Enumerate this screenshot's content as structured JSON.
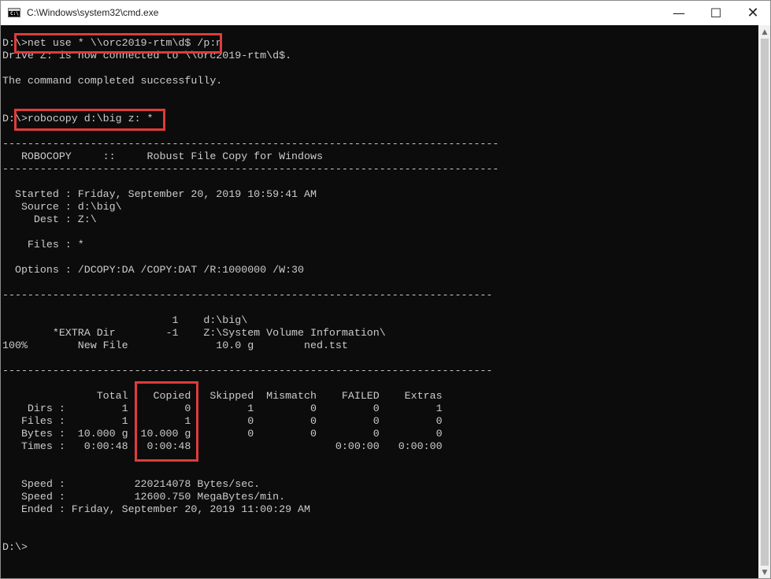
{
  "window": {
    "title": "C:\\Windows\\system32\\cmd.exe",
    "icon_text": "C:\\",
    "minimize_glyph": "—",
    "maximize_glyph": "☐",
    "close_glyph": "✕"
  },
  "console": {
    "lines": [
      "D:\\>net use * \\\\orc2019-rtm\\d$ /p:n",
      "Drive Z: is now connected to \\\\orc2019-rtm\\d$.",
      "",
      "The command completed successfully.",
      "",
      "",
      "D:\\>robocopy d:\\big z: *",
      "",
      "-------------------------------------------------------------------------------",
      "   ROBOCOPY     ::     Robust File Copy for Windows",
      "-------------------------------------------------------------------------------",
      "",
      "  Started : Friday, September 20, 2019 10:59:41 AM",
      "   Source : d:\\big\\",
      "     Dest : Z:\\",
      "",
      "    Files : *",
      "",
      "  Options : /DCOPY:DA /COPY:DAT /R:1000000 /W:30",
      "",
      "------------------------------------------------------------------------------",
      "",
      "                           1    d:\\big\\",
      "        *EXTRA Dir        -1    Z:\\System Volume Information\\",
      "100%        New File              10.0 g        ned.tst",
      "",
      "------------------------------------------------------------------------------",
      "",
      "               Total    Copied   Skipped  Mismatch    FAILED    Extras",
      "    Dirs :         1         0         1         0         0         1",
      "   Files :         1         1         0         0         0         0",
      "   Bytes :  10.000 g  10.000 g         0         0         0         0",
      "   Times :   0:00:48   0:00:48                       0:00:00   0:00:00",
      "",
      "",
      "   Speed :           220214078 Bytes/sec.",
      "   Speed :           12600.750 MegaBytes/min.",
      "   Ended : Friday, September 20, 2019 11:00:29 AM",
      "",
      "",
      "D:\\>"
    ]
  },
  "colors": {
    "background": "#0c0c0c",
    "text": "#cccccc",
    "highlight": "#e03b3b"
  }
}
